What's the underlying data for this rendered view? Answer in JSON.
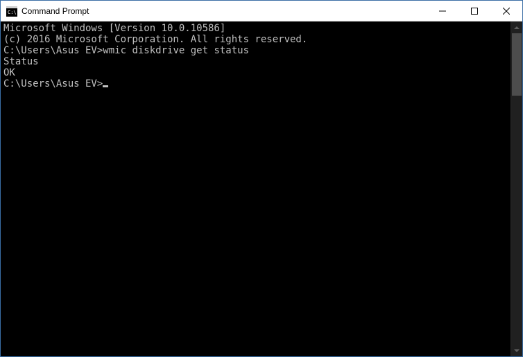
{
  "window": {
    "title": "Command Prompt"
  },
  "console": {
    "line1": "Microsoft Windows [Version 10.0.10586]",
    "line2": "(c) 2016 Microsoft Corporation. All rights reserved.",
    "blank1": "",
    "prompt1_path": "C:\\Users\\Asus EV>",
    "command1": "wmic diskdrive get status",
    "output_header": "Status",
    "output_value": "OK",
    "blank2": "",
    "blank3": "",
    "prompt2_path": "C:\\Users\\Asus EV>"
  }
}
